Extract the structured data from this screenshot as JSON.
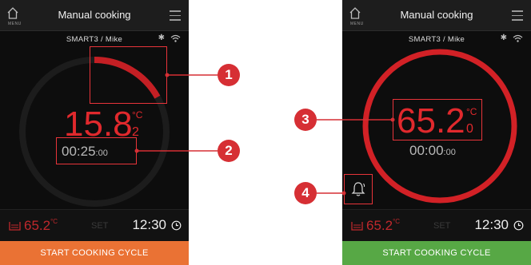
{
  "left_screen": {
    "title": "Manual cooking",
    "menu_label": "MENU",
    "subtitle": "SMART3 / Mike",
    "temperature_main": "15.8",
    "temperature_decimal": "2",
    "temperature_unit": "°C",
    "timer_main": "00:25",
    "timer_seconds": ":00",
    "footer_temp": "65.2",
    "footer_temp_unit": "°C",
    "set_label": "SET",
    "clock": "12:30",
    "start_button": "START COOKING CYCLE",
    "start_button_color": "#ea7234",
    "progress_fraction": 0.17
  },
  "right_screen": {
    "title": "Manual cooking",
    "menu_label": "MENU",
    "subtitle": "SMART3 / Mike",
    "temperature_main": "65.2",
    "temperature_decimal": "0",
    "temperature_unit": "°C",
    "timer_main": "00:00",
    "timer_seconds": ":00",
    "footer_temp": "65.2",
    "footer_temp_unit": "°C",
    "set_label": "SET",
    "clock": "12:30",
    "start_button": "START COOKING CYCLE",
    "start_button_color": "#57a845",
    "progress_fraction": 1.0
  },
  "callouts": [
    "1",
    "2",
    "3",
    "4"
  ],
  "colors": {
    "accent_red": "#e1292d",
    "callout_red": "#d62f34",
    "screen_bg": "#0d0d0d"
  }
}
